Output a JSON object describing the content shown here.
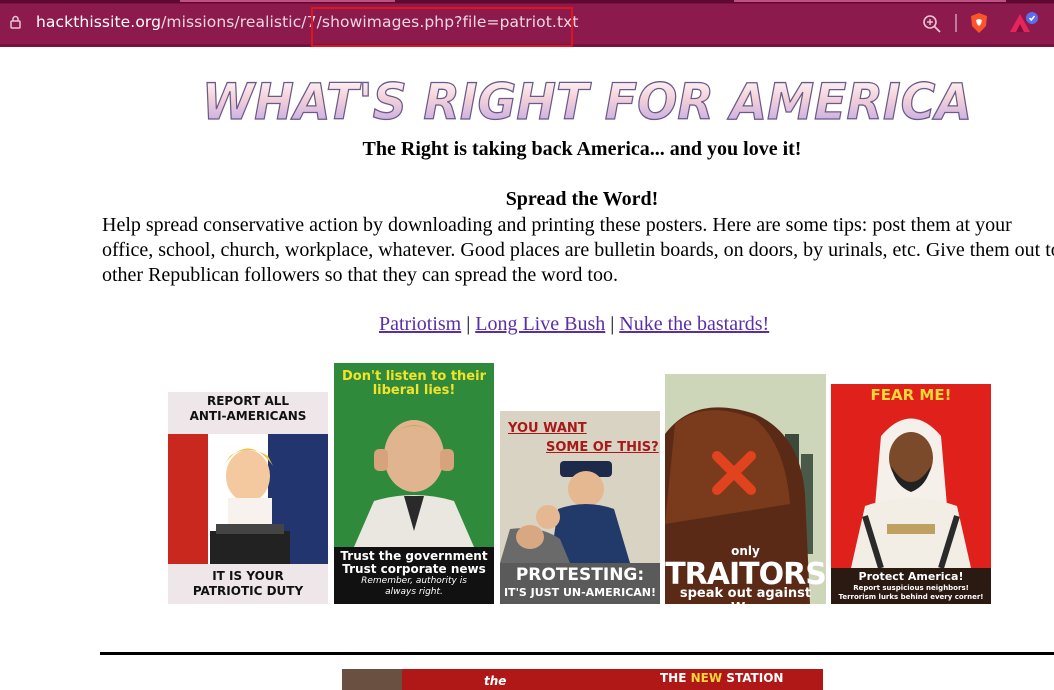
{
  "browser": {
    "url_host": "hackthissite.org",
    "url_path": "/missions/realistic/7/showimages.php?file=patriot.txt",
    "accent": "#7a1040"
  },
  "page": {
    "banner": "WHAT'S RIGHT FOR AMERICA",
    "tagline": "The Right is taking back America... and you love it!",
    "spread_heading": "Spread the Word!",
    "body": "Help spread conservative action by downloading and printing these posters. Here are some tips: post them at your office, school, church, workplace, whatever. Good places are bulletin boards, on doors, by urinals, etc. Give them out to other Republican followers so that they can spread the word too.",
    "links": [
      {
        "label": "Patriotism"
      },
      {
        "label": "Long Live Bush"
      },
      {
        "label": "Nuke the bastards!"
      }
    ],
    "separator": "|",
    "link_color": "#5a2ea6"
  },
  "posters": [
    {
      "top": "REPORT ALL",
      "top2": "ANTI-AMERICANS",
      "bottom": "IT IS YOUR",
      "bottom2": "PATRIOTIC DUTY"
    },
    {
      "top": "Don't listen to their",
      "top2": "liberal lies!",
      "bottom": "Trust the government",
      "bottom2": "Trust corporate news",
      "bottom3": "Remember, authority is",
      "bottom4": "always right."
    },
    {
      "top": "YOU WANT",
      "top2": "SOME OF THIS?",
      "bottom": "PROTESTING:",
      "bottom2": "IT'S JUST UN-AMERICAN!"
    },
    {
      "top": "only",
      "top2": "TRAITORS",
      "bottom": "speak out against War"
    },
    {
      "top": "FEAR ME!",
      "bottom": "Protect America!",
      "bottom2": "Report suspicious neighbors!",
      "bottom3": "Terrorism lurks behind every corner!"
    }
  ],
  "bottom_banner": {
    "text1": "the",
    "text2": "THE",
    "text3": "NEW",
    "text4": "STATION"
  }
}
